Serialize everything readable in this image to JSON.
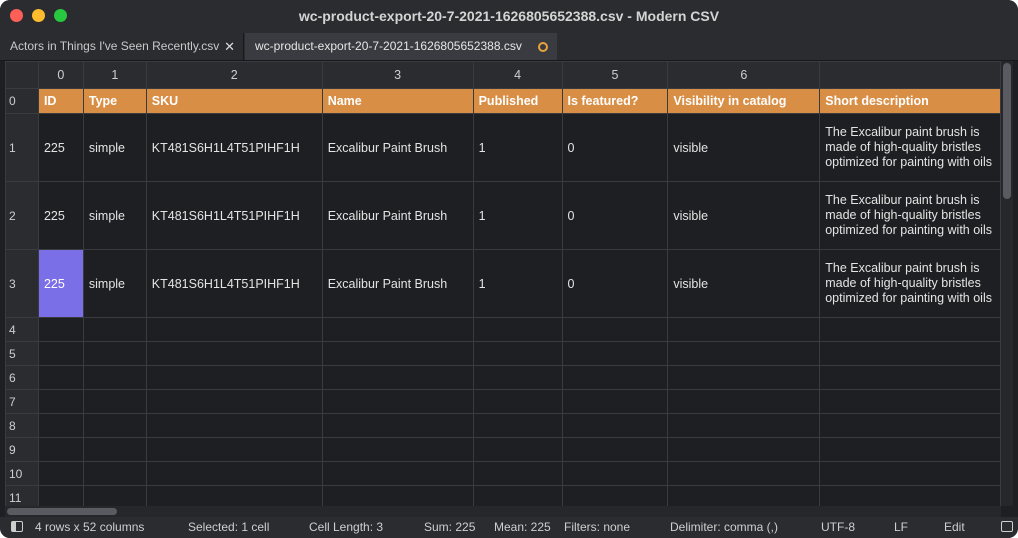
{
  "window": {
    "title": "wc-product-export-20-7-2021-1626805652388.csv - Modern CSV"
  },
  "tabs": [
    {
      "label": "Actors in Things I've Seen Recently.csv",
      "close": "✕"
    },
    {
      "label": "wc-product-export-20-7-2021-1626805652388.csv"
    }
  ],
  "columns": [
    "0",
    "1",
    "2",
    "3",
    "4",
    "5",
    "6",
    ""
  ],
  "rows": [
    {
      "index": "0",
      "cells": [
        "ID",
        "Type",
        "SKU",
        "Name",
        "Published",
        "Is featured?",
        "Visibility in catalog",
        "Short description"
      ]
    },
    {
      "index": "1",
      "cells": [
        "225",
        "simple",
        "KT481S6H1L4T51PIHF1H",
        "Excalibur Paint Brush",
        "1",
        "0",
        "visible",
        "The Excalibur paint brush is made of high-quality bristles optimized for painting with oils"
      ]
    },
    {
      "index": "2",
      "cells": [
        "225",
        "simple",
        "KT481S6H1L4T51PIHF1H",
        "Excalibur Paint Brush",
        "1",
        "0",
        "visible",
        "The Excalibur paint brush is made of high-quality bristles optimized for painting with oils"
      ]
    },
    {
      "index": "3",
      "cells": [
        "225",
        "simple",
        "KT481S6H1L4T51PIHF1H",
        "Excalibur Paint Brush",
        "1",
        "0",
        "visible",
        "The Excalibur paint brush is made of high-quality bristles optimized for painting with oils"
      ]
    }
  ],
  "empty_rows": [
    "4",
    "5",
    "6",
    "7",
    "8",
    "9",
    "10",
    "11"
  ],
  "status": {
    "dimensions": "4 rows x 52 columns",
    "selected": "Selected: 1 cell",
    "cell_length": "Cell Length: 3",
    "sum": "Sum: 225",
    "mean": "Mean: 225",
    "filters": "Filters: none",
    "delimiter": "Delimiter: comma (,)",
    "encoding": "UTF-8",
    "line_ending": "LF",
    "mode": "Edit"
  },
  "colors": {
    "header_row": "#d98e45",
    "selection": "#7b6fe8",
    "unsaved_dot": "#e8a33a"
  }
}
